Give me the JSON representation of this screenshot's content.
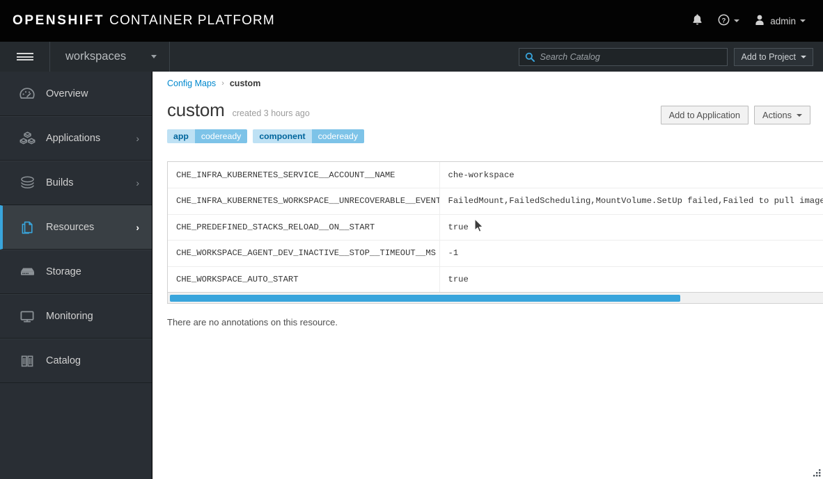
{
  "masthead": {
    "brand_bold": "OPENSHIFT",
    "brand_light": "CONTAINER PLATFORM",
    "notifications_icon": "bell-icon",
    "help_icon": "help-circle-icon",
    "user_icon": "user-icon",
    "username": "admin"
  },
  "secondbar": {
    "menu_icon": "hamburger-icon",
    "project_name": "workspaces",
    "search": {
      "icon": "search-icon",
      "placeholder": "Search Catalog",
      "value": ""
    },
    "add_to_project_label": "Add to Project"
  },
  "sidebar": {
    "items": [
      {
        "label": "Overview",
        "icon": "dashboard-icon",
        "active": false,
        "has_chevron": false
      },
      {
        "label": "Applications",
        "icon": "cubes-icon",
        "active": false,
        "has_chevron": true
      },
      {
        "label": "Builds",
        "icon": "layers-icon",
        "active": false,
        "has_chevron": true
      },
      {
        "label": "Resources",
        "icon": "documents-icon",
        "active": true,
        "has_chevron": true
      },
      {
        "label": "Storage",
        "icon": "database-icon",
        "active": false,
        "has_chevron": false
      },
      {
        "label": "Monitoring",
        "icon": "monitor-icon",
        "active": false,
        "has_chevron": false
      },
      {
        "label": "Catalog",
        "icon": "book-icon",
        "active": false,
        "has_chevron": false
      }
    ]
  },
  "content": {
    "breadcrumb": {
      "parent": "Config Maps",
      "separator": "›",
      "current": "custom"
    },
    "title": "custom",
    "created_meta": "created 3 hours ago",
    "buttons": {
      "add_to_application": "Add to Application",
      "actions": "Actions"
    },
    "labels": [
      {
        "key": "app",
        "value": "codeready"
      },
      {
        "key": "component",
        "value": "codeready"
      }
    ],
    "table": {
      "rows": [
        {
          "key": "CHE_INFRA_KUBERNETES_SERVICE__ACCOUNT__NAME",
          "value": "che-workspace"
        },
        {
          "key": "CHE_INFRA_KUBERNETES_WORKSPACE__UNRECOVERABLE__EVENTS",
          "value": "FailedMount,FailedScheduling,MountVolume.SetUp failed,Failed to pull image"
        },
        {
          "key": "CHE_PREDEFINED_STACKS_RELOAD__ON__START",
          "value": "true"
        },
        {
          "key": "CHE_WORKSPACE_AGENT_DEV_INACTIVE__STOP__TIMEOUT__MS",
          "value": "-1"
        },
        {
          "key": "CHE_WORKSPACE_AUTO_START",
          "value": "true"
        }
      ]
    },
    "annotations_note": "There are no annotations on this resource.",
    "scrollbar": {
      "orientation": "horizontal",
      "thumb_color": "#39a5dc"
    }
  },
  "colors": {
    "masthead_bg": "#030303",
    "secondbar_bg": "#252a2e",
    "sidebar_bg": "#292e34",
    "sidebar_active_bg": "#393f44",
    "accent_blue": "#39a5dc",
    "link_blue": "#0088ce",
    "label_key_bg": "#bee1f4",
    "label_val_bg": "#7dc3e8"
  }
}
